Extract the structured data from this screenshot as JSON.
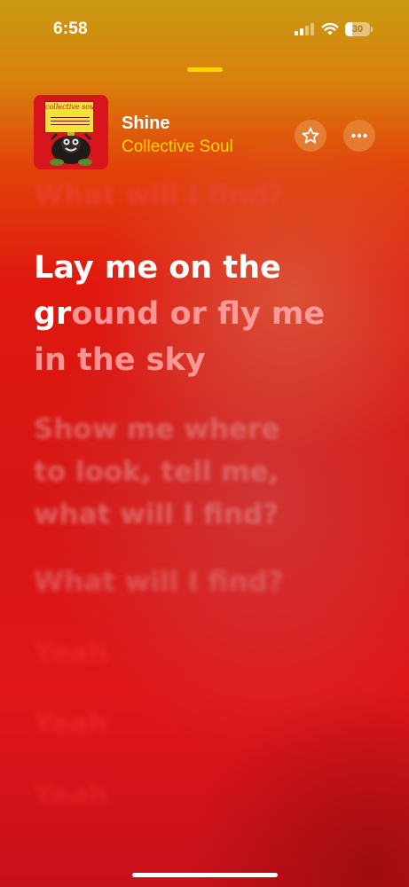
{
  "status_bar": {
    "time": "6:58",
    "battery_level": "30"
  },
  "now_playing": {
    "title": "Shine",
    "artist": "Collective Soul",
    "artwork_text": "collective soul"
  },
  "lyrics": {
    "previous": "What will I find?",
    "current": {
      "line_1": "Lay me on the",
      "sung_part_line_2": "gr",
      "unsung_part_line_2": "ound or fly me",
      "line_3": "in the sky"
    },
    "upcoming": [
      {
        "lines": [
          "Show me where",
          "to look, tell me,",
          "what will I find?"
        ]
      },
      {
        "lines": [
          "What will I find?"
        ]
      },
      {
        "lines": [
          "Yeah"
        ]
      },
      {
        "lines": [
          "Yeah"
        ]
      },
      {
        "lines": [
          "Yeah"
        ]
      }
    ]
  },
  "icons": {
    "favorite": "star-icon",
    "more": "ellipsis-icon",
    "signal": "cellular-signal-icon",
    "wifi": "wifi-icon",
    "battery": "battery-icon"
  },
  "colors": {
    "accent": "#ffd400",
    "text_primary": "#ffffff",
    "background_top": "#c99a12",
    "background_mid": "#e01810"
  }
}
